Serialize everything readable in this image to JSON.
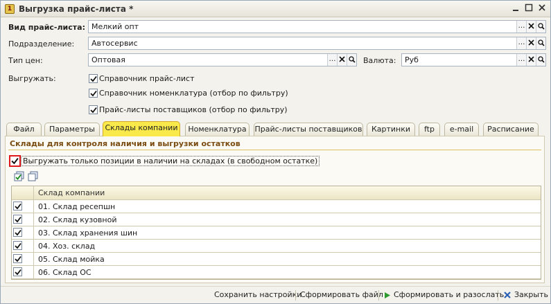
{
  "window": {
    "title": "Выгрузка прайс-листа *",
    "icon": "app-1c-icon"
  },
  "form": {
    "price_list_type": {
      "label": "Вид прайс-листа:",
      "value": "Мелкий опт"
    },
    "department": {
      "label": "Подразделение:",
      "value": "Автосервис"
    },
    "price_type": {
      "label": "Тип цен:",
      "value": "Оптовая"
    },
    "currency": {
      "label": "Валюта:",
      "value": "Руб"
    },
    "export": {
      "label": "Выгружать:",
      "options": [
        {
          "label": "Справочник прайс-лист",
          "checked": true
        },
        {
          "label": "Справочник номенклатура (отбор по фильтру)",
          "checked": true
        },
        {
          "label": "Прайс-листы поставщиков (отбор по фильтру)",
          "checked": true
        }
      ]
    }
  },
  "tabs": [
    {
      "label": "Файл",
      "active": false
    },
    {
      "label": "Параметры",
      "active": false
    },
    {
      "label": "Склады компании",
      "active": true
    },
    {
      "label": "Номенклатура",
      "active": false
    },
    {
      "label": "Прайс-листы поставщиков",
      "active": false
    },
    {
      "label": "Картинки",
      "active": false
    },
    {
      "label": "ftp",
      "active": false
    },
    {
      "label": "e-mail",
      "active": false
    },
    {
      "label": "Расписание",
      "active": false
    }
  ],
  "warehouses": {
    "section_title": "Склады для контроля наличия и выгрузки остатков",
    "only_in_stock": {
      "label": "Выгружать только позиции в наличии на складах (в свободном остатке)",
      "checked": true
    },
    "column_header": "Склад компании",
    "rows": [
      {
        "name": "01. Склад ресепшн",
        "checked": true
      },
      {
        "name": "02. Склад кузовной",
        "checked": true
      },
      {
        "name": "03. Склад хранения шин",
        "checked": true
      },
      {
        "name": "04. Хоз. склад",
        "checked": true
      },
      {
        "name": "05. Склад мойка",
        "checked": true
      },
      {
        "name": "06. Склад ОС",
        "checked": true
      }
    ]
  },
  "footer": {
    "save_settings": "Сохранить настройки",
    "generate_file": "Сформировать файл",
    "generate_and_send": "Сформировать и разослать",
    "close": "Закрыть"
  },
  "colors": {
    "active_tab": "#f9e94a",
    "only_stock_highlight": "#e0191d",
    "section_title": "#7a4c12"
  }
}
